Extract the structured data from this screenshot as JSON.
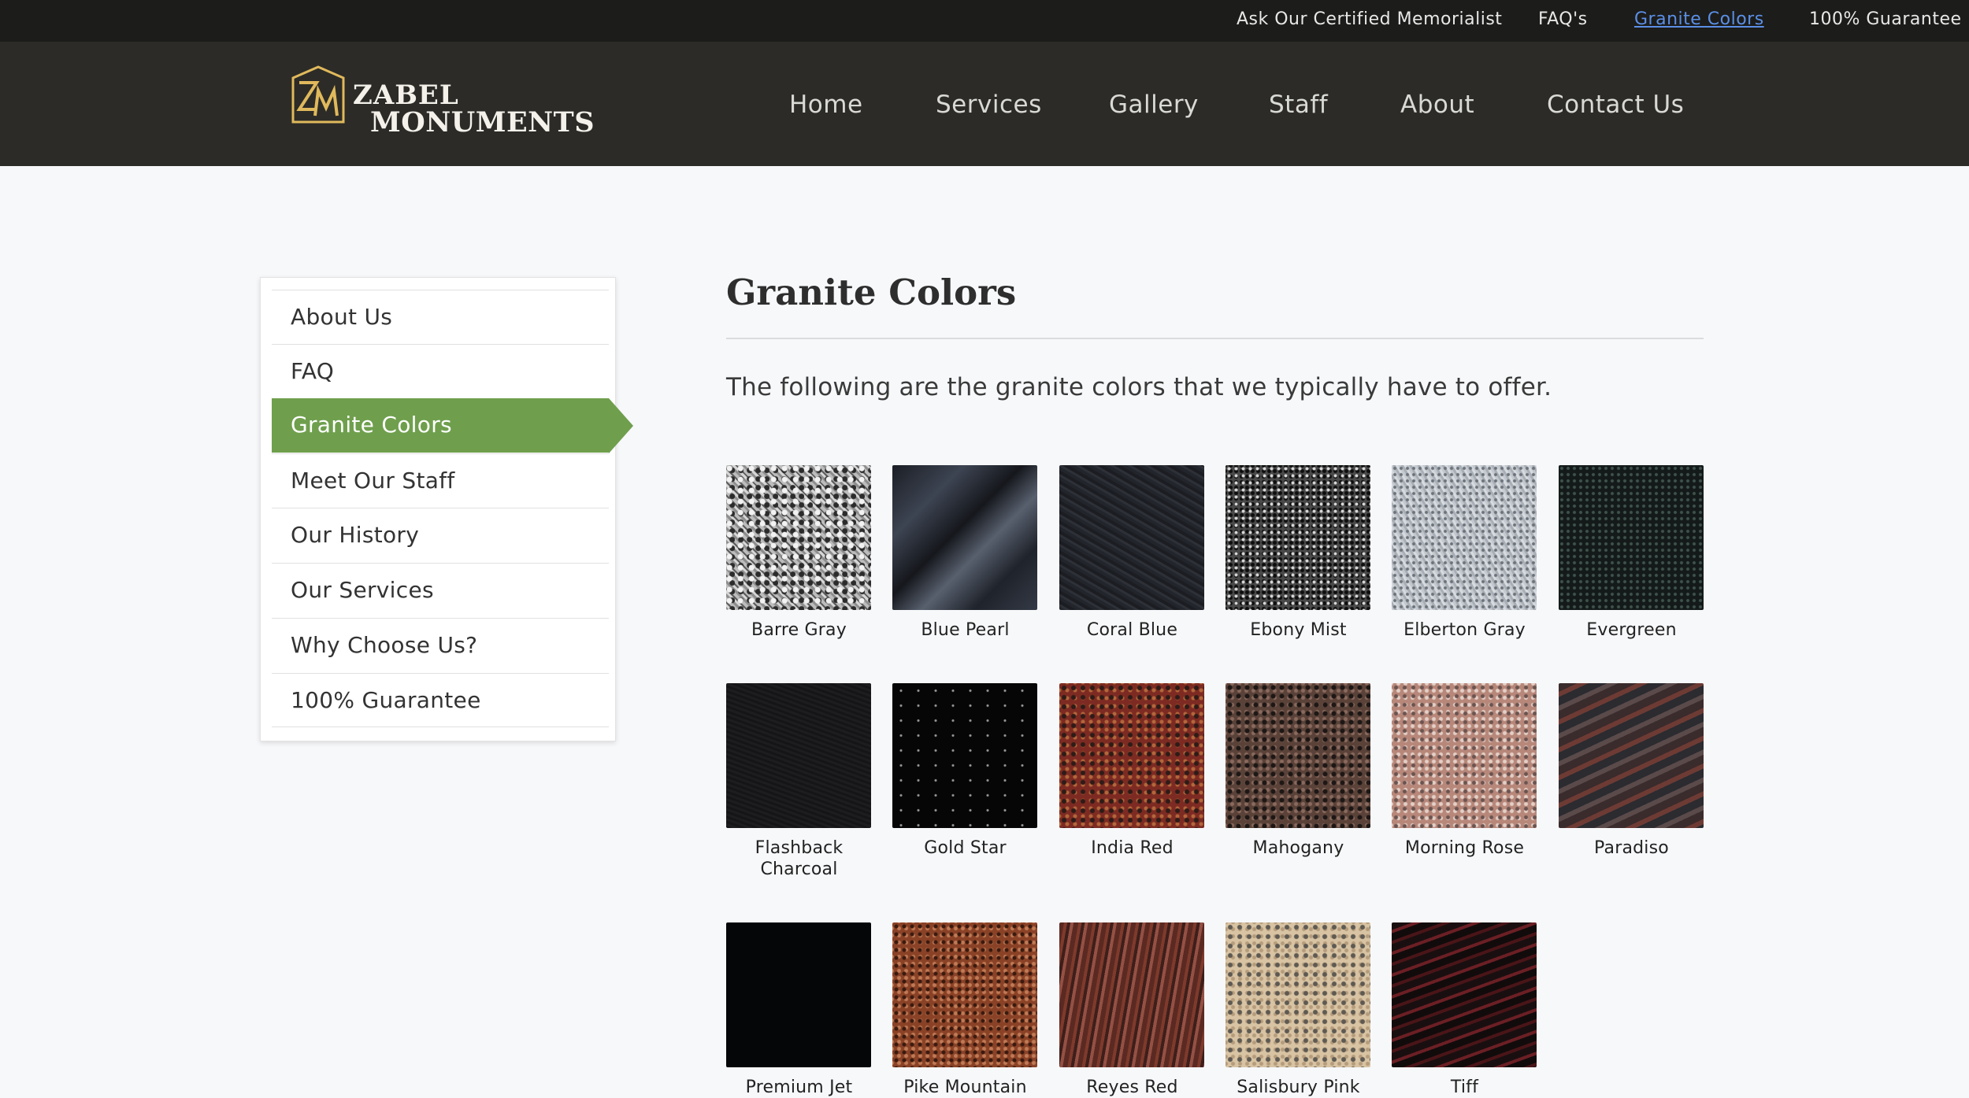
{
  "topbar": {
    "links": [
      {
        "label": "Ask Our Certified Memorialist"
      },
      {
        "label": "FAQ's"
      },
      {
        "label": "Granite Colors",
        "active": true
      },
      {
        "label": "100% Guarantee"
      }
    ]
  },
  "header": {
    "logo": {
      "mark": "ZM",
      "line1": "ZABEL",
      "line2": "MONUMENTS"
    },
    "nav": [
      "Home",
      "Services",
      "Gallery",
      "Staff",
      "About",
      "Contact Us"
    ]
  },
  "sidebar": {
    "items": [
      "About Us",
      "FAQ",
      "Granite Colors",
      "Meet Our Staff",
      "Our History",
      "Our Services",
      "Why Choose Us?",
      "100% Guarantee"
    ],
    "active": "Granite Colors"
  },
  "main": {
    "title": "Granite Colors",
    "intro": "The following are the granite colors that we typically have to offer.",
    "swatches": [
      {
        "label": "Barre Gray"
      },
      {
        "label": "Blue Pearl"
      },
      {
        "label": "Coral Blue"
      },
      {
        "label": "Ebony Mist"
      },
      {
        "label": "Elberton Gray"
      },
      {
        "label": "Evergreen"
      },
      {
        "label": "Flashback Charcoal"
      },
      {
        "label": "Gold Star"
      },
      {
        "label": "India Red"
      },
      {
        "label": "Mahogany"
      },
      {
        "label": "Morning Rose"
      },
      {
        "label": "Paradiso"
      },
      {
        "label": "Premium Jet"
      },
      {
        "label": "Pike Mountain"
      },
      {
        "label": "Reyes Red"
      },
      {
        "label": "Salisbury Pink"
      },
      {
        "label": "Tiff"
      }
    ]
  },
  "colors": {
    "topbar_bg": "#1c1c1a",
    "header_bg": "#2c2b27",
    "active_link": "#5b8fe6",
    "sidebar_active": "#6f9f4d"
  }
}
